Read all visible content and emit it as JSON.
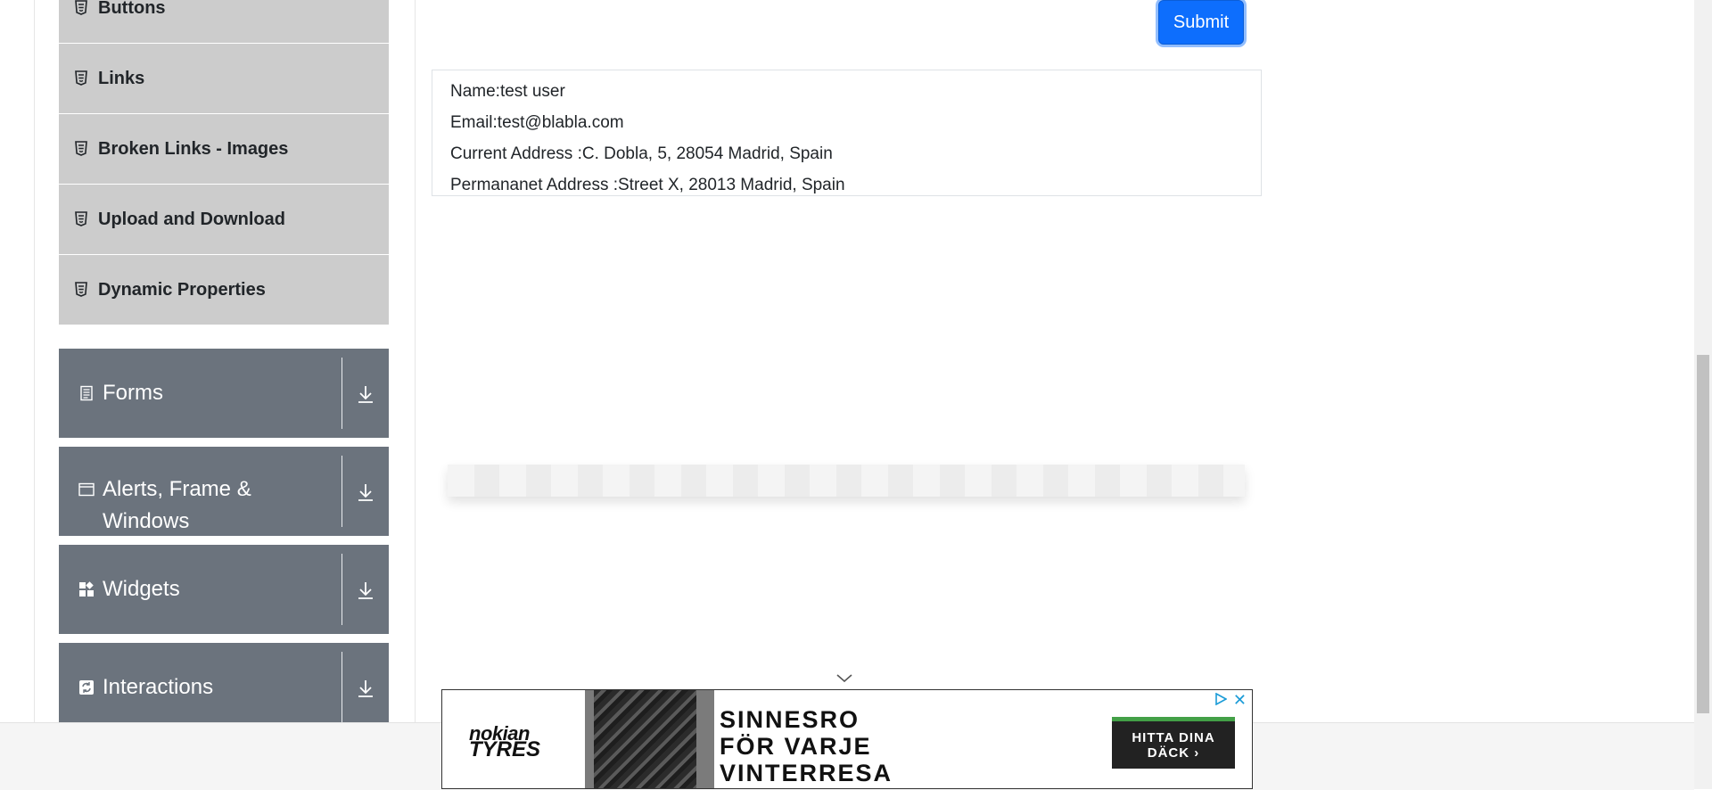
{
  "sidebar": {
    "elements_items": [
      {
        "label": "Buttons",
        "icon": "html5-icon"
      },
      {
        "label": "Links",
        "icon": "html5-icon"
      },
      {
        "label": "Broken Links - Images",
        "icon": "html5-icon"
      },
      {
        "label": "Upload and Download",
        "icon": "html5-icon"
      },
      {
        "label": "Dynamic Properties",
        "icon": "html5-icon"
      }
    ],
    "groups": [
      {
        "label": "Forms",
        "icon": "document-icon"
      },
      {
        "label": "Alerts, Frame & Windows",
        "icon": "window-icon"
      },
      {
        "label": "Widgets",
        "icon": "widgets-icon"
      },
      {
        "label": "Interactions",
        "icon": "interactions-icon"
      }
    ]
  },
  "form": {
    "submit_label": "Submit"
  },
  "output": {
    "name": "Name:test user",
    "email": "Email:test@blabla.com",
    "current_address": "Current Address :C. Dobla, 5, 28054 Madrid, Spain",
    "permanent_address": "Permananet Address :Street X, 28013 Madrid, Spain"
  },
  "ad": {
    "brand_line1": "nokian",
    "brand_line2": "TYRES",
    "headline_1": "SINNESRO",
    "headline_2": "FÖR VARJE",
    "headline_3": "VINTERRESA",
    "cta_line1": "HITTA DINA",
    "cta_line2": "DÄCK ›",
    "close_symbol": "✕"
  },
  "colors": {
    "sidebar_sub_bg": "#cccccc",
    "sidebar_group_bg": "#6b737d",
    "submit_bg": "#0d6efd"
  }
}
